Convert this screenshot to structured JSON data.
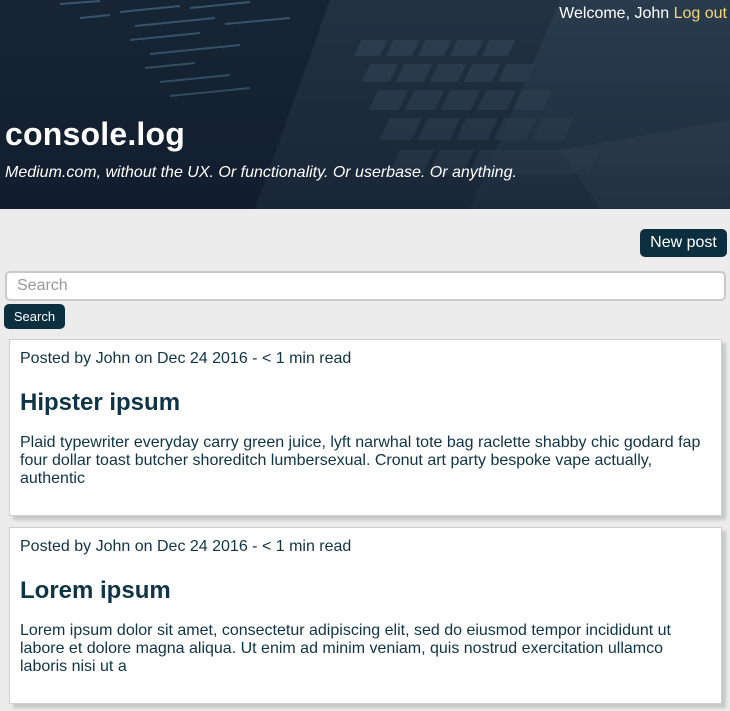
{
  "header": {
    "welcome_prefix": "Welcome, John",
    "logout_label": "Log out",
    "site_title": "console.log",
    "tagline": "Medium.com, without the UX. Or functionality. Or userbase. Or anything."
  },
  "toolbar": {
    "new_post_label": "New post"
  },
  "search": {
    "placeholder": "Search",
    "value": "",
    "button_label": "Search"
  },
  "posts": [
    {
      "meta": "Posted by John on Dec 24 2016 - < 1 min read",
      "title": "Hipster ipsum",
      "excerpt": "Plaid typewriter everyday carry green juice, lyft narwhal tote bag raclette shabby chic godard fap four dollar toast butcher shoreditch lumbersexual. Cronut art party bespoke vape actually, authentic"
    },
    {
      "meta": "Posted by John on Dec 24 2016 - < 1 min read",
      "title": "Lorem ipsum",
      "excerpt": "Lorem ipsum dolor sit amet, consectetur adipiscing elit, sed do eiusmod tempor incididunt ut labore et dolore magna aliqua. Ut enim ad minim veniam, quis nostrud exercitation ullamco laboris nisi ut a"
    }
  ],
  "colors": {
    "accent": "#0c2f40",
    "text": "#0f3446",
    "logout_link": "#f5d77a",
    "page_background": "#ececec"
  }
}
